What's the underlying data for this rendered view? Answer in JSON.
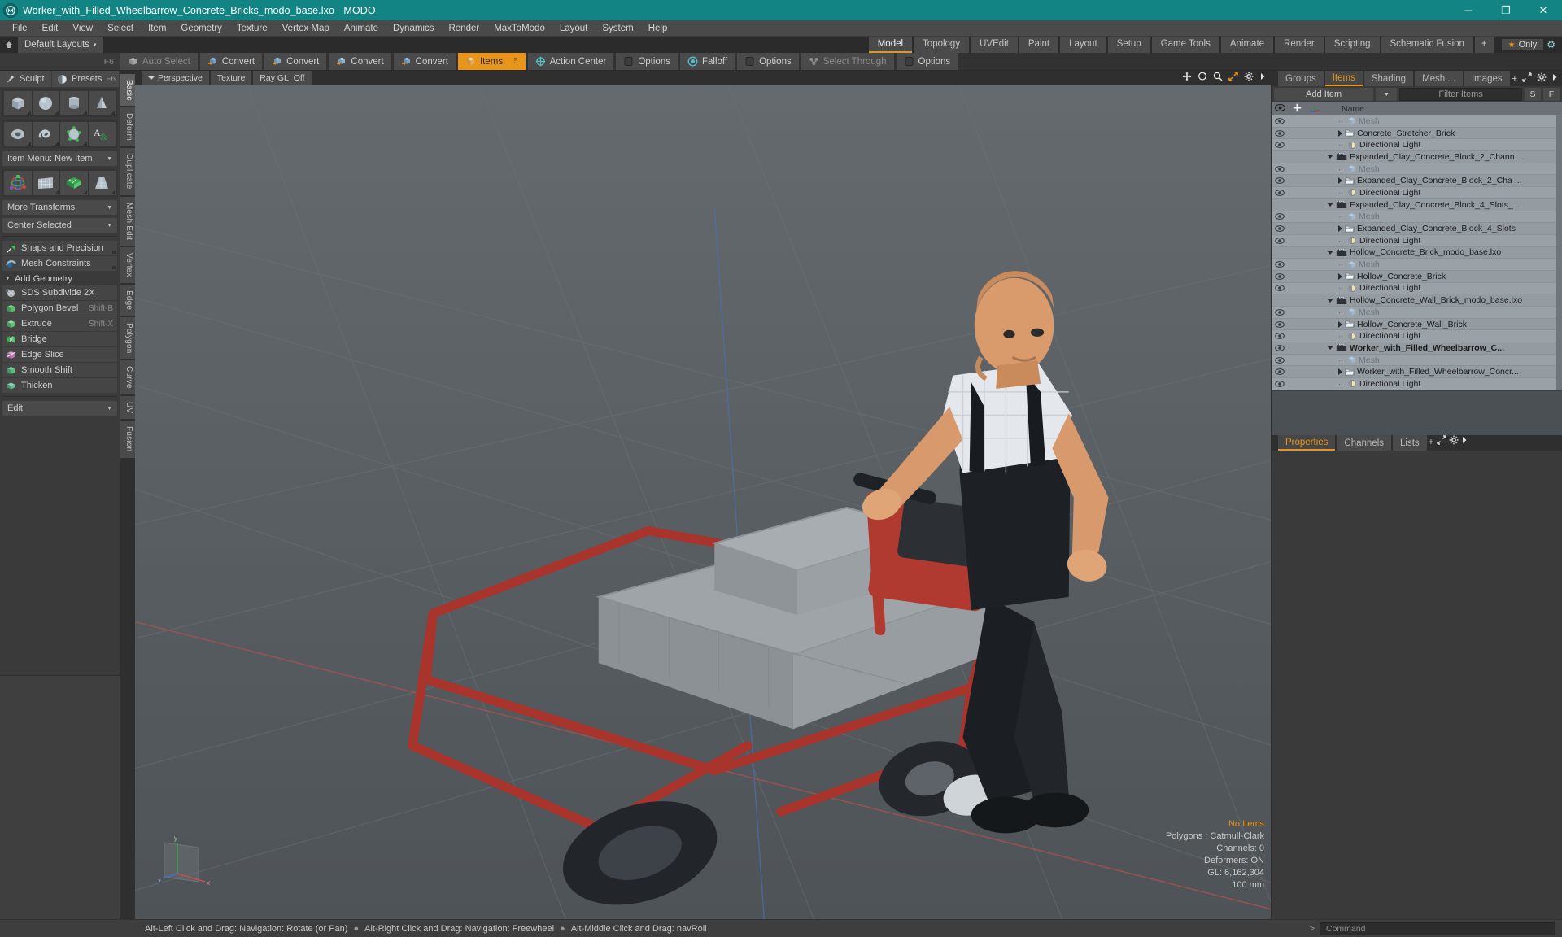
{
  "titlebar": {
    "title": "Worker_with_Filled_Wheelbarrow_Concrete_Bricks_modo_base.lxo - MODO",
    "app_icon": "modo-logo-icon",
    "minimize": "─",
    "maximize": "❐",
    "close": "✕"
  },
  "menubar": {
    "items": [
      "File",
      "Edit",
      "View",
      "Select",
      "Item",
      "Geometry",
      "Texture",
      "Vertex Map",
      "Animate",
      "Dynamics",
      "Render",
      "MaxToModo",
      "Layout",
      "System",
      "Help"
    ]
  },
  "layoutbar": {
    "default_layouts": "Default Layouts",
    "caret": "▾",
    "tabs": [
      {
        "label": "Model",
        "active": true
      },
      {
        "label": "Topology",
        "active": false
      },
      {
        "label": "UVEdit",
        "active": false
      },
      {
        "label": "Paint",
        "active": false
      },
      {
        "label": "Layout",
        "active": false
      },
      {
        "label": "Setup",
        "active": false
      },
      {
        "label": "Game Tools",
        "active": false
      },
      {
        "label": "Animate",
        "active": false
      },
      {
        "label": "Render",
        "active": false
      },
      {
        "label": "Scripting",
        "active": false
      },
      {
        "label": "Schematic Fusion",
        "active": false
      }
    ],
    "add_tab": "+",
    "only_label": "Only",
    "star": "★",
    "gear": "⚙"
  },
  "toolbar": {
    "f6": "F6",
    "buttons": [
      {
        "label": "Auto Select",
        "icon": "cube-grey-icon",
        "state": "dim"
      },
      {
        "label": "Convert",
        "icon": "convert-vertex-icon",
        "state": "normal"
      },
      {
        "label": "Convert",
        "icon": "convert-edge-icon",
        "state": "normal"
      },
      {
        "label": "Convert",
        "icon": "convert-polygon-icon",
        "state": "normal"
      },
      {
        "label": "Convert",
        "icon": "convert-material-icon",
        "state": "normal"
      },
      {
        "label": "Items",
        "icon": "items-cube-icon",
        "state": "active",
        "badge": "5"
      },
      {
        "label": "Action Center",
        "icon": "action-center-icon",
        "state": "normal"
      },
      {
        "label": "Options",
        "icon": "options-square-icon",
        "state": "normal"
      },
      {
        "label": "Falloff",
        "icon": "falloff-target-icon",
        "state": "normal"
      },
      {
        "label": "Options",
        "icon": "options-square-icon",
        "state": "normal"
      },
      {
        "label": "Select Through",
        "icon": "select-through-icon",
        "state": "dim"
      },
      {
        "label": "Options",
        "icon": "options-square-icon",
        "state": "normal"
      }
    ]
  },
  "left_panel": {
    "tabs": [
      {
        "label": "Sculpt",
        "icon": "sculpt-brush-icon"
      },
      {
        "label": "Presets",
        "icon": "presets-sphere-icon",
        "shortcut": "F6"
      }
    ],
    "primitives_row1": [
      "cube-icon",
      "sphere-icon",
      "cylinder-icon",
      "cone-icon"
    ],
    "primitives_row2": [
      "torus-icon",
      "spiral-icon",
      "polygon-vertex-icon",
      "text-icon"
    ],
    "item_menu": "Item Menu: New Item",
    "transform_row": [
      "transform-gizmo-icon",
      "grid-plane-icon",
      "bend-plane-icon",
      "taper-plane-icon"
    ],
    "more_transforms": "More Transforms",
    "center_selected": "Center Selected",
    "snaps": {
      "label": "Snaps and Precision",
      "icon": "snap-arrow-icon"
    },
    "constraints": {
      "label": "Mesh Constraints",
      "icon": "mesh-constraint-icon"
    },
    "add_geometry_header": "Add Geometry",
    "geometry_tools": [
      {
        "label": "SDS Subdivide 2X",
        "icon": "sds-subdivide-icon",
        "shortcut": ""
      },
      {
        "label": "Polygon Bevel",
        "icon": "polygon-bevel-icon",
        "shortcut": "Shift-B"
      },
      {
        "label": "Extrude",
        "icon": "extrude-icon",
        "shortcut": "Shift-X"
      },
      {
        "label": "Bridge",
        "icon": "bridge-icon",
        "shortcut": ""
      },
      {
        "label": "Edge Slice",
        "icon": "edge-slice-icon",
        "shortcut": ""
      },
      {
        "label": "Smooth Shift",
        "icon": "smooth-shift-icon",
        "shortcut": ""
      },
      {
        "label": "Thicken",
        "icon": "thicken-icon",
        "shortcut": ""
      }
    ],
    "edit_dropdown": "Edit"
  },
  "mode_tabs": [
    {
      "label": "Basic",
      "active": true
    },
    {
      "label": "Deform",
      "active": false
    },
    {
      "label": "Duplicate",
      "active": false
    },
    {
      "label": "Mesh Edit",
      "active": false
    },
    {
      "label": "Vertex",
      "active": false
    },
    {
      "label": "Edge",
      "active": false
    },
    {
      "label": "Polygon",
      "active": false
    },
    {
      "label": "Curve",
      "active": false
    },
    {
      "label": "UV",
      "active": false
    },
    {
      "label": "Fusion",
      "active": false
    }
  ],
  "viewport": {
    "tabs": [
      {
        "label": "Perspective",
        "icon": "viewport-caret-icon"
      },
      {
        "label": "Texture",
        "icon": ""
      },
      {
        "label": "Ray GL: Off",
        "icon": ""
      }
    ],
    "icons": [
      "move-icon",
      "rotate-icon",
      "zoom-icon",
      "fit-icon",
      "gear-icon",
      "arrow-right-icon"
    ],
    "stats": {
      "selection": "No Items",
      "polygons": "Polygons : Catmull-Clark",
      "channels": "Channels: 0",
      "deformers": "Deformers: ON",
      "gl": "GL: 6,162,304",
      "scale": "100 mm"
    },
    "axis_labels": {
      "y": "y",
      "x": "x",
      "z": "z"
    }
  },
  "right_panel": {
    "tabs": [
      {
        "label": "Groups",
        "active": false
      },
      {
        "label": "Items",
        "active": true
      },
      {
        "label": "Shading",
        "active": false
      },
      {
        "label": "Mesh ...",
        "active": false
      },
      {
        "label": "Images",
        "active": false
      }
    ],
    "add_tab": "+",
    "icons": [
      "expand-icon",
      "gear-icon",
      "arrow-right-icon"
    ],
    "add_item": "Add Item",
    "add_item_caret": "▾",
    "filter_placeholder": "Filter Items",
    "s_button": "S",
    "f_button": "F",
    "columns": {
      "eye": "eye-icon",
      "lock": "lock-icon",
      "axis": "axis-icon",
      "name": "Name"
    },
    "rows": [
      {
        "label": "Mesh",
        "icon": "mesh-cube-icon",
        "indent": 1,
        "toggle": "none",
        "eye": true,
        "dim": true,
        "bold": false
      },
      {
        "label": "Concrete_Stretcher_Brick",
        "icon": "mesh-folder-icon",
        "indent": 1,
        "toggle": "right",
        "eye": true,
        "dim": false,
        "bold": false
      },
      {
        "label": "Directional Light",
        "icon": "light-icon",
        "indent": 1,
        "toggle": "none",
        "eye": true,
        "dim": false,
        "bold": false
      },
      {
        "label": "Expanded_Clay_Concrete_Block_2_Chann ...",
        "icon": "scene-icon",
        "indent": 0,
        "toggle": "down",
        "eye": false,
        "dim": false,
        "bold": false
      },
      {
        "label": "Mesh",
        "icon": "mesh-cube-icon",
        "indent": 1,
        "toggle": "none",
        "eye": true,
        "dim": true,
        "bold": false
      },
      {
        "label": "Expanded_Clay_Concrete_Block_2_Cha ...",
        "icon": "mesh-folder-icon",
        "indent": 1,
        "toggle": "right",
        "eye": true,
        "dim": false,
        "bold": false
      },
      {
        "label": "Directional Light",
        "icon": "light-icon",
        "indent": 1,
        "toggle": "none",
        "eye": true,
        "dim": false,
        "bold": false
      },
      {
        "label": "Expanded_Clay_Concrete_Block_4_Slots_ ...",
        "icon": "scene-icon",
        "indent": 0,
        "toggle": "down",
        "eye": false,
        "dim": false,
        "bold": false
      },
      {
        "label": "Mesh",
        "icon": "mesh-cube-icon",
        "indent": 1,
        "toggle": "none",
        "eye": true,
        "dim": true,
        "bold": false
      },
      {
        "label": "Expanded_Clay_Concrete_Block_4_Slots",
        "icon": "mesh-folder-icon",
        "indent": 1,
        "toggle": "right",
        "eye": true,
        "dim": false,
        "bold": false
      },
      {
        "label": "Directional Light",
        "icon": "light-icon",
        "indent": 1,
        "toggle": "none",
        "eye": true,
        "dim": false,
        "bold": false
      },
      {
        "label": "Hollow_Concrete_Brick_modo_base.lxo",
        "icon": "scene-icon",
        "indent": 0,
        "toggle": "down",
        "eye": false,
        "dim": false,
        "bold": false
      },
      {
        "label": "Mesh",
        "icon": "mesh-cube-icon",
        "indent": 1,
        "toggle": "none",
        "eye": true,
        "dim": true,
        "bold": false
      },
      {
        "label": "Hollow_Concrete_Brick",
        "icon": "mesh-folder-icon",
        "indent": 1,
        "toggle": "right",
        "eye": true,
        "dim": false,
        "bold": false
      },
      {
        "label": "Directional Light",
        "icon": "light-icon",
        "indent": 1,
        "toggle": "none",
        "eye": true,
        "dim": false,
        "bold": false
      },
      {
        "label": "Hollow_Concrete_Wall_Brick_modo_base.lxo",
        "icon": "scene-icon",
        "indent": 0,
        "toggle": "down",
        "eye": false,
        "dim": false,
        "bold": false
      },
      {
        "label": "Mesh",
        "icon": "mesh-cube-icon",
        "indent": 1,
        "toggle": "none",
        "eye": true,
        "dim": true,
        "bold": false
      },
      {
        "label": "Hollow_Concrete_Wall_Brick",
        "icon": "mesh-folder-icon",
        "indent": 1,
        "toggle": "right",
        "eye": true,
        "dim": false,
        "bold": false
      },
      {
        "label": "Directional Light",
        "icon": "light-icon",
        "indent": 1,
        "toggle": "none",
        "eye": true,
        "dim": false,
        "bold": false
      },
      {
        "label": "Worker_with_Filled_Wheelbarrow_C...",
        "icon": "scene-icon",
        "indent": 0,
        "toggle": "down",
        "eye": true,
        "dim": false,
        "bold": true
      },
      {
        "label": "Mesh",
        "icon": "mesh-cube-icon",
        "indent": 1,
        "toggle": "none",
        "eye": true,
        "dim": true,
        "bold": false
      },
      {
        "label": "Worker_with_Filled_Wheelbarrow_Concr...",
        "icon": "mesh-folder-icon",
        "indent": 1,
        "toggle": "right",
        "eye": true,
        "dim": false,
        "bold": false
      },
      {
        "label": "Directional Light",
        "icon": "light-icon",
        "indent": 1,
        "toggle": "none",
        "eye": true,
        "dim": false,
        "bold": false
      }
    ]
  },
  "properties_panel": {
    "tabs": [
      {
        "label": "Properties",
        "active": true
      },
      {
        "label": "Channels",
        "active": false
      },
      {
        "label": "Lists",
        "active": false
      }
    ],
    "add_tab": "+",
    "icons": [
      "expand-icon",
      "gear-icon",
      "arrow-right-icon"
    ]
  },
  "statusbar": {
    "hints": [
      "Alt-Left Click and Drag: Navigation: Rotate (or Pan)",
      "Alt-Right Click and Drag: Navigation: Freewheel",
      "Alt-Middle Click and Drag: navRoll"
    ],
    "bullet": "●",
    "command_prompt": ">",
    "command_placeholder": "Command"
  },
  "colors": {
    "title_teal": "#128484",
    "accent_orange": "#e8951b",
    "panel_grey": "#3a3a3a",
    "tree_blue_grey": "#9aa1a7",
    "viewport_grey": "#5a6064"
  }
}
